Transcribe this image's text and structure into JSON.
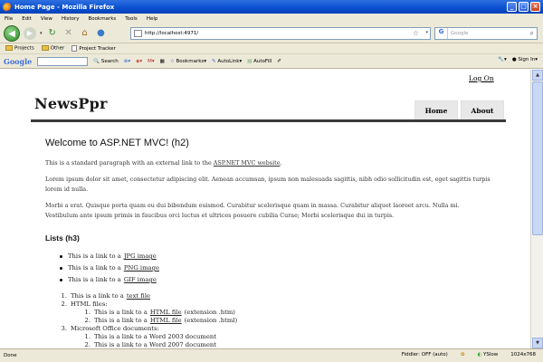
{
  "window": {
    "title": "Home Page - Mozilla Firefox"
  },
  "menu": [
    "File",
    "Edit",
    "View",
    "History",
    "Bookmarks",
    "Tools",
    "Help"
  ],
  "nav": {
    "url": "http://localhost:4971/",
    "search_placeholder": "Google"
  },
  "bookmarks": [
    "Projects",
    "Other",
    "Project Tracker"
  ],
  "google_toolbar": {
    "logo": "Google",
    "search": "Search",
    "bookmarks": "Bookmarks",
    "autolink": "AutoLink",
    "autofill": "AutoFill",
    "signin": "Sign In"
  },
  "page": {
    "login": "Log On",
    "logo": "NewsPpr",
    "tabs": [
      "Home",
      "About"
    ],
    "heading": "Welcome to ASP.NET MVC! (h2)",
    "intro_text": "This is a standard paragraph with an external link to the",
    "intro_link": "ASP.NET MVC website",
    "intro_end": ".",
    "lorem1": "Lorem ipsum dolor sit amet, consectetur adipiscing elit. Aenean accumsan, ipsum non malesuada sagittis, nibh odio sollicitudin est, eget sagittis turpis lorem id nulla.",
    "lorem2": "Morbi a erat. Quisque porta quam eu dui bibendum euismod. Curabitur scelerisque quam in massa. Curabitur aliquet laoreet arcu. Nulla mi. Vestibulum ante ipsum primis in faucibus orci luctus et ultrices posuere cubilia Curae; Morbi scelerisque dui in turpis.",
    "lists_heading": "Lists (h3)",
    "bullets": [
      {
        "prefix": "This is a link to a",
        "link": "JPG image"
      },
      {
        "prefix": "This is a link to a",
        "link": "PNG image"
      },
      {
        "prefix": "This is a link to a",
        "link": "GIF image"
      }
    ],
    "ordered": {
      "item1_prefix": "This is a link to a",
      "item1_link": "text file",
      "item2": "HTML files:",
      "item2a_prefix": "This is a link to a",
      "item2a_link": "HTML file",
      "item2a_suffix": "(extension .htm)",
      "item2b_prefix": "This is a link to a",
      "item2b_link": "HTML file",
      "item2b_suffix": "(extension .html)",
      "item3": "Microsoft Office documents:",
      "item3a": "This is a link to a Word 2003 document",
      "item3b": "This is a link to a Word 2007 document",
      "nums": [
        "1.",
        "2.",
        "1.",
        "2.",
        "3.",
        "1.",
        "2."
      ]
    }
  },
  "status": {
    "left": "Done",
    "fiddler": "Fiddler: OFF (auto)",
    "yslow": "YSlow",
    "resolution": "1024x768"
  }
}
